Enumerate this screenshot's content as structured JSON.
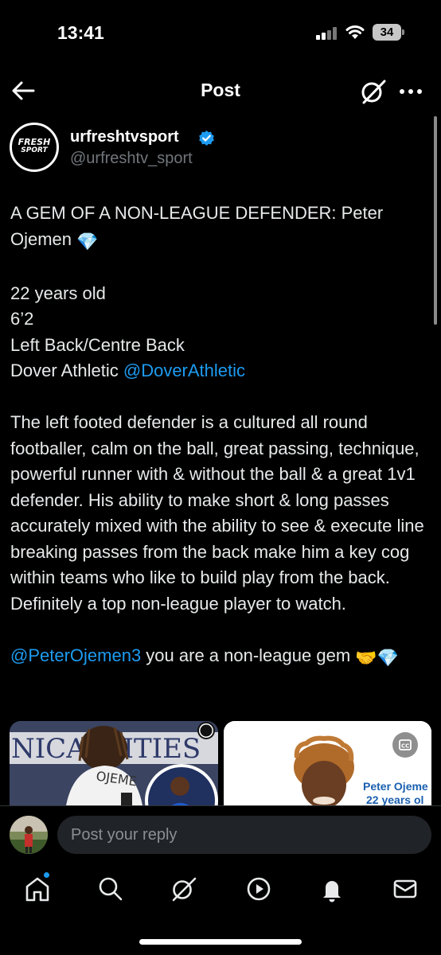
{
  "status": {
    "time": "13:41",
    "battery": "34"
  },
  "header": {
    "title": "Post",
    "back_icon": "arrow-left-icon",
    "grok_icon": "grok-icon",
    "more_icon": "more-horizontal-icon"
  },
  "author": {
    "avatar_line1": "FRESH",
    "avatar_line2": "SPORT",
    "name": "urfreshtvsport",
    "handle": "@urfreshtv_sport",
    "verified_color": "#1d9bf0"
  },
  "tweet": {
    "headline": "A GEM OF A NON-LEAGUE DEFENDER: Peter Ojemen",
    "headline_emoji": "💎",
    "details": [
      "22 years old",
      "6’2",
      "Left Back/Centre Back"
    ],
    "club_text": "Dover Athletic",
    "club_mention": "@DoverAthletic",
    "description": "The left footed defender is a cultured all round footballer, calm on the ball, great passing, technique, powerful runner with & without the ball & a great 1v1 defender. His ability to make short & long passes accurately mixed with the ability to see & execute line breaking passes from the back make him a key cog within teams who like to build play from the back. Definitely a top non-league player to watch.",
    "closing_mention": "@PeterOjemen3",
    "closing_text": " you are a non-league gem ",
    "closing_emojis": "🤝💎"
  },
  "media": {
    "image1_text_overlay": "NICA  ILITIES",
    "image1_shirt_text": "OJEME",
    "image2_caption_line1": "Peter Ojeme",
    "image2_caption_line2": "22 years ol",
    "cc_icon": "captions-icon"
  },
  "reply": {
    "placeholder": "Post your reply"
  },
  "nav": {
    "items": [
      "home-icon",
      "search-icon",
      "grok-icon",
      "video-icon",
      "notifications-icon",
      "messages-icon"
    ],
    "accent": "#1d9bf0"
  }
}
